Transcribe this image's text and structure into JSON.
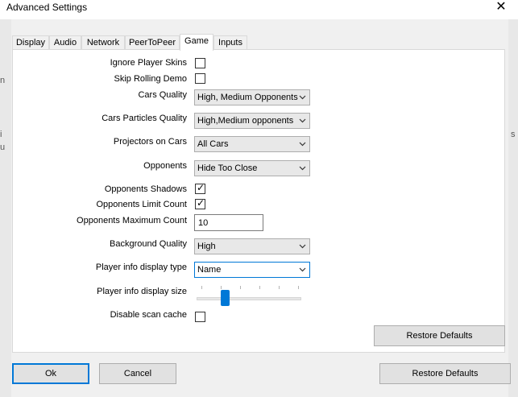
{
  "window": {
    "title": "Advanced Settings",
    "close_glyph": "✕"
  },
  "background_glyphs": [
    "n",
    "i",
    "u",
    "s"
  ],
  "tabs": [
    {
      "label": "Display",
      "active": false
    },
    {
      "label": "Audio",
      "active": false
    },
    {
      "label": "Network",
      "active": false
    },
    {
      "label": "PeerToPeer",
      "active": false
    },
    {
      "label": "Game",
      "active": true
    },
    {
      "label": "Inputs",
      "active": false
    }
  ],
  "settings": {
    "ignore_player_skins": {
      "label": "Ignore Player Skins",
      "checked": false
    },
    "skip_rolling_demo": {
      "label": "Skip Rolling Demo",
      "checked": false
    },
    "cars_quality": {
      "label": "Cars Quality",
      "value": "High, Medium Opponents"
    },
    "cars_particles_quality": {
      "label": "Cars Particles Quality",
      "value": "High,Medium opponents"
    },
    "projectors_on_cars": {
      "label": "Projectors on Cars",
      "value": "All Cars"
    },
    "opponents": {
      "label": "Opponents",
      "value": "Hide Too Close"
    },
    "opponents_shadows": {
      "label": "Opponents Shadows",
      "checked": true
    },
    "opponents_limit_count": {
      "label": "Opponents Limit Count",
      "checked": true
    },
    "opponents_maximum_count": {
      "label": "Opponents Maximum Count",
      "value": "10"
    },
    "background_quality": {
      "label": "Background Quality",
      "value": "High"
    },
    "player_info_display_type": {
      "label": "Player info display type",
      "value": "Name"
    },
    "player_info_display_size": {
      "label": "Player info display size",
      "slider_fraction": 0.25,
      "tick_count": 6
    },
    "disable_scan_cache": {
      "label": "Disable scan cache",
      "checked": false
    }
  },
  "checkmark_glyph": "✓",
  "buttons": {
    "restore_defaults_tab": "Restore Defaults",
    "ok": "Ok",
    "cancel": "Cancel",
    "restore_defaults": "Restore Defaults"
  },
  "colors": {
    "accent": "#0078d7",
    "dialog_bg": "#f0f0f0",
    "panel_bg": "#ffffff"
  },
  "icons": {
    "close": "close-icon",
    "dropdown": "chevron-down-icon",
    "checkmark": "checkmark-icon"
  }
}
